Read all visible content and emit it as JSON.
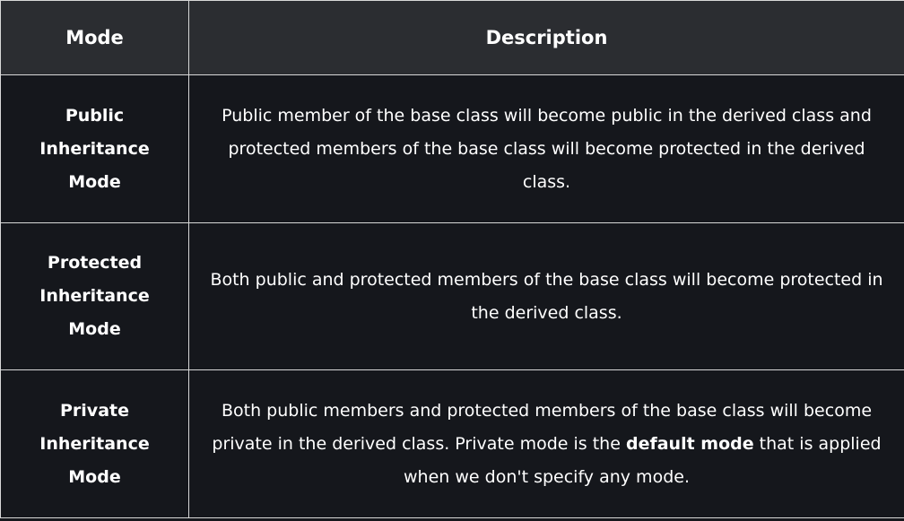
{
  "table": {
    "headers": {
      "mode": "Mode",
      "description": "Description"
    },
    "rows": [
      {
        "mode": "Public Inheritance Mode",
        "description": "Public member of the base class will become public in the derived class and protected members of the base class will become protected in the derived class."
      },
      {
        "mode": "Protected Inheritance Mode",
        "description": "Both public and protected members of the base class will become protected in the derived class."
      },
      {
        "mode": "Private Inheritance Mode",
        "description_before": "Both public members and protected members of the base class will become private in the derived class. Private mode is the",
        "description_bold": "default mode",
        "description_after": "that is applied when we don't specify any mode."
      }
    ]
  }
}
